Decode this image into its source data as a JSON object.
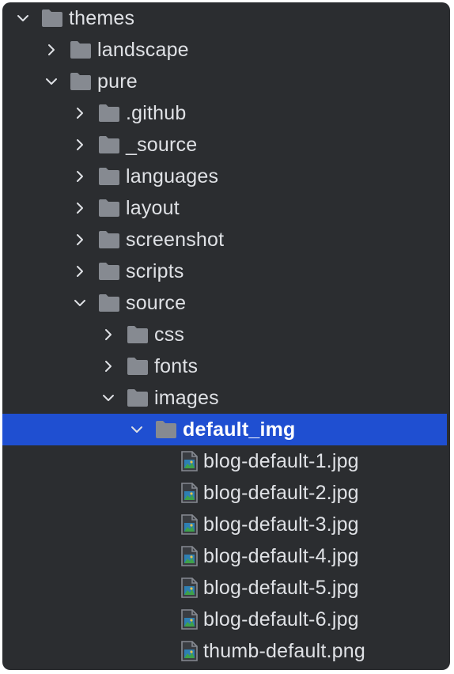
{
  "tree": [
    {
      "label": "themes",
      "type": "folder",
      "depth": 0,
      "expanded": true,
      "name": "tree-item-themes"
    },
    {
      "label": "landscape",
      "type": "folder",
      "depth": 1,
      "expanded": false,
      "name": "tree-item-landscape"
    },
    {
      "label": "pure",
      "type": "folder",
      "depth": 1,
      "expanded": true,
      "name": "tree-item-pure"
    },
    {
      "label": ".github",
      "type": "folder",
      "depth": 2,
      "expanded": false,
      "name": "tree-item-github"
    },
    {
      "label": "_source",
      "type": "folder",
      "depth": 2,
      "expanded": false,
      "name": "tree-item-source-underscore"
    },
    {
      "label": "languages",
      "type": "folder",
      "depth": 2,
      "expanded": false,
      "name": "tree-item-languages"
    },
    {
      "label": "layout",
      "type": "folder",
      "depth": 2,
      "expanded": false,
      "name": "tree-item-layout"
    },
    {
      "label": "screenshot",
      "type": "folder",
      "depth": 2,
      "expanded": false,
      "name": "tree-item-screenshot"
    },
    {
      "label": "scripts",
      "type": "folder",
      "depth": 2,
      "expanded": false,
      "name": "tree-item-scripts"
    },
    {
      "label": "source",
      "type": "folder",
      "depth": 2,
      "expanded": true,
      "name": "tree-item-source"
    },
    {
      "label": "css",
      "type": "folder",
      "depth": 3,
      "expanded": false,
      "name": "tree-item-css"
    },
    {
      "label": "fonts",
      "type": "folder",
      "depth": 3,
      "expanded": false,
      "name": "tree-item-fonts"
    },
    {
      "label": "images",
      "type": "folder",
      "depth": 3,
      "expanded": true,
      "name": "tree-item-images"
    },
    {
      "label": "default_img",
      "type": "folder",
      "depth": 4,
      "expanded": true,
      "selected": true,
      "name": "tree-item-default-img"
    },
    {
      "label": "blog-default-1.jpg",
      "type": "image",
      "depth": 5,
      "name": "tree-item-blog-default-1"
    },
    {
      "label": "blog-default-2.jpg",
      "type": "image",
      "depth": 5,
      "name": "tree-item-blog-default-2"
    },
    {
      "label": "blog-default-3.jpg",
      "type": "image",
      "depth": 5,
      "name": "tree-item-blog-default-3"
    },
    {
      "label": "blog-default-4.jpg",
      "type": "image",
      "depth": 5,
      "name": "tree-item-blog-default-4"
    },
    {
      "label": "blog-default-5.jpg",
      "type": "image",
      "depth": 5,
      "name": "tree-item-blog-default-5"
    },
    {
      "label": "blog-default-6.jpg",
      "type": "image",
      "depth": 5,
      "name": "tree-item-blog-default-6"
    },
    {
      "label": "thumb-default.png",
      "type": "image",
      "depth": 5,
      "name": "tree-item-thumb-default"
    }
  ],
  "colors": {
    "background": "#2b2d30",
    "selection": "#1f4fd1",
    "text": "#dfe1e5",
    "folder_icon": "#868a91",
    "arrow": "#dfe1e5"
  },
  "icons": {
    "expanded": "chevron-down-icon",
    "collapsed": "chevron-right-icon",
    "folder": "folder-icon",
    "image": "image-file-icon"
  }
}
